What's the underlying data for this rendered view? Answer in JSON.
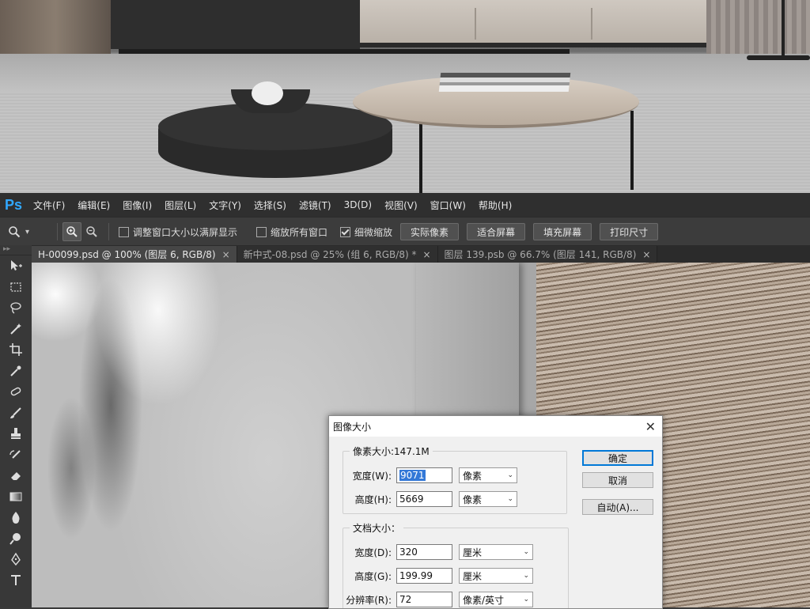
{
  "app": {
    "logo": "Ps"
  },
  "menu": [
    "文件(F)",
    "编辑(E)",
    "图像(I)",
    "图层(L)",
    "文字(Y)",
    "选择(S)",
    "滤镜(T)",
    "3D(D)",
    "视图(V)",
    "窗口(W)",
    "帮助(H)"
  ],
  "options": {
    "zoom_arrow": "▾",
    "checkbox_resize": {
      "label": "调整窗口大小以满屏显示",
      "checked": false
    },
    "checkbox_all": {
      "label": "缩放所有窗口",
      "checked": false
    },
    "checkbox_scrubby": {
      "label": "细微缩放",
      "checked": true
    },
    "buttons": [
      "实际像素",
      "适合屏幕",
      "填充屏幕",
      "打印尺寸"
    ]
  },
  "tabs": [
    {
      "label": "H-00099.psd @ 100% (图层 6, RGB/8)",
      "close": "×",
      "active": true
    },
    {
      "label": "新中式-08.psd @ 25% (组 6, RGB/8) *",
      "close": "×",
      "active": false
    },
    {
      "label": "图层 139.psb @ 66.7% (图层 141, RGB/8)",
      "close": "×",
      "active": false
    }
  ],
  "toolbox": {
    "grip": "▸▸",
    "tools": [
      "move-tool-icon",
      "marquee-tool-icon",
      "lasso-tool-icon",
      "magic-wand-icon",
      "crop-tool-icon",
      "eyedropper-icon",
      "healing-brush-icon",
      "brush-tool-icon",
      "clone-stamp-icon",
      "history-brush-icon",
      "eraser-icon",
      "gradient-tool-icon",
      "blur-tool-icon",
      "dodge-tool-icon",
      "pen-tool-icon",
      "type-tool-icon"
    ]
  },
  "dialog": {
    "title": "图像大小",
    "close": "✕",
    "pixel_group": "像素大小:147.1M",
    "width_label": "宽度(W):",
    "width_value": "9071",
    "width_unit": "像素",
    "height_label": "高度(H):",
    "height_value": "5669",
    "height_unit": "像素",
    "doc_group": "文档大小：",
    "doc_width_label": "宽度(D):",
    "doc_width_value": "320",
    "doc_width_unit": "厘米",
    "doc_height_label": "高度(G):",
    "doc_height_value": "199.99",
    "doc_height_unit": "厘米",
    "resolution_label": "分辨率(R):",
    "resolution_value": "72",
    "resolution_unit": "像素/英寸",
    "ok": "确定",
    "cancel": "取消",
    "auto": "自动(A)...",
    "arrow": "⌄"
  },
  "colors": {
    "accent": "#31a8ff",
    "menubar": "#2f2f2f",
    "optbar": "#3c3c3c",
    "dialog_bg": "#f0f0f0",
    "selection": "#3378d7"
  }
}
